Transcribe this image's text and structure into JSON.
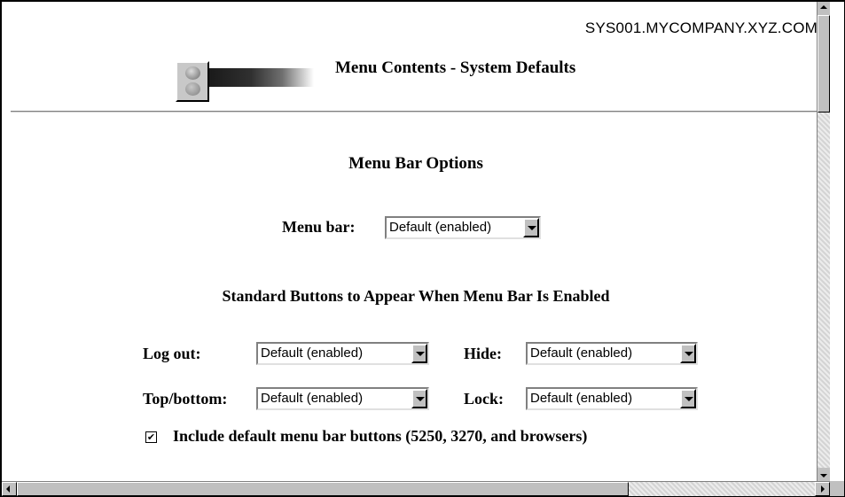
{
  "header": {
    "hostname": "SYS001.MYCOMPANY.XYZ.COM",
    "title": "Menu Contents - System Defaults"
  },
  "menu_bar_options": {
    "heading": "Menu Bar Options",
    "menu_bar_label": "Menu bar:",
    "menu_bar_value": "Default (enabled)"
  },
  "standard_buttons": {
    "heading": "Standard Buttons to Appear When Menu Bar Is Enabled",
    "log_out_label": "Log out:",
    "log_out_value": "Default (enabled)",
    "hide_label": "Hide:",
    "hide_value": "Default (enabled)",
    "top_bottom_label": "Top/bottom:",
    "top_bottom_value": "Default (enabled)",
    "lock_label": "Lock:",
    "lock_value": "Default (enabled)",
    "include_default_label": "Include default menu bar buttons (5250, 3270, and browsers)",
    "include_default_checked": true
  },
  "colors": {
    "background": "#ffffff",
    "chrome": "#c0c0c0"
  }
}
